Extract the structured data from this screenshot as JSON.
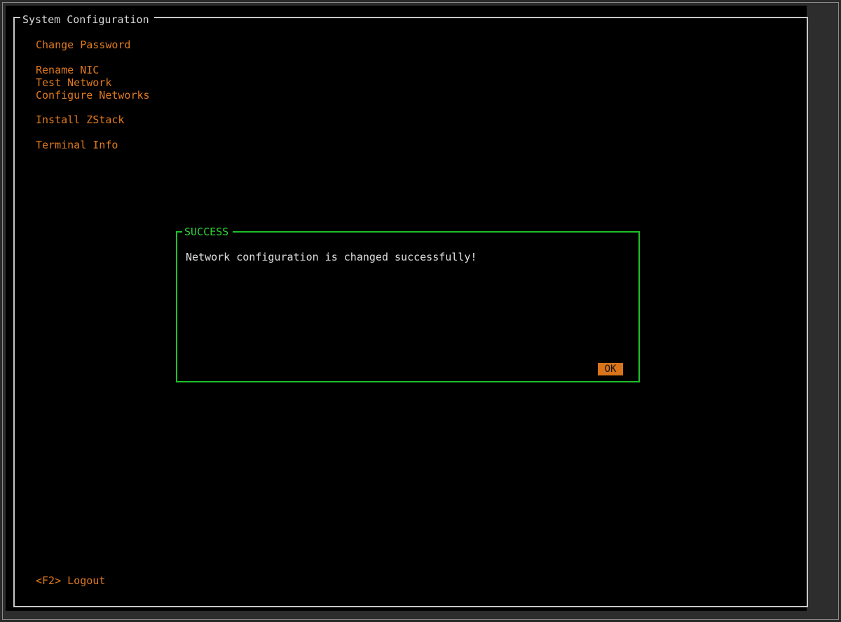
{
  "main": {
    "title": "System Configuration",
    "menu": [
      {
        "id": "change-password",
        "label": "Change Password"
      },
      {
        "id": "rename-nic",
        "label": "Rename NIC"
      },
      {
        "id": "test-network",
        "label": "Test Network"
      },
      {
        "id": "configure-networks",
        "label": "Configure Networks"
      },
      {
        "id": "install-zstack",
        "label": "Install ZStack"
      },
      {
        "id": "terminal-info",
        "label": "Terminal Info"
      }
    ],
    "footer_hint": "<F2> Logout"
  },
  "dialog": {
    "title": "SUCCESS",
    "message": "Network configuration is changed successfully!",
    "ok_label": "OK"
  },
  "colors": {
    "menu_text": "#e07a1f",
    "dialog_border": "#1fbf2a",
    "ok_button_bg": "#d9741a"
  }
}
